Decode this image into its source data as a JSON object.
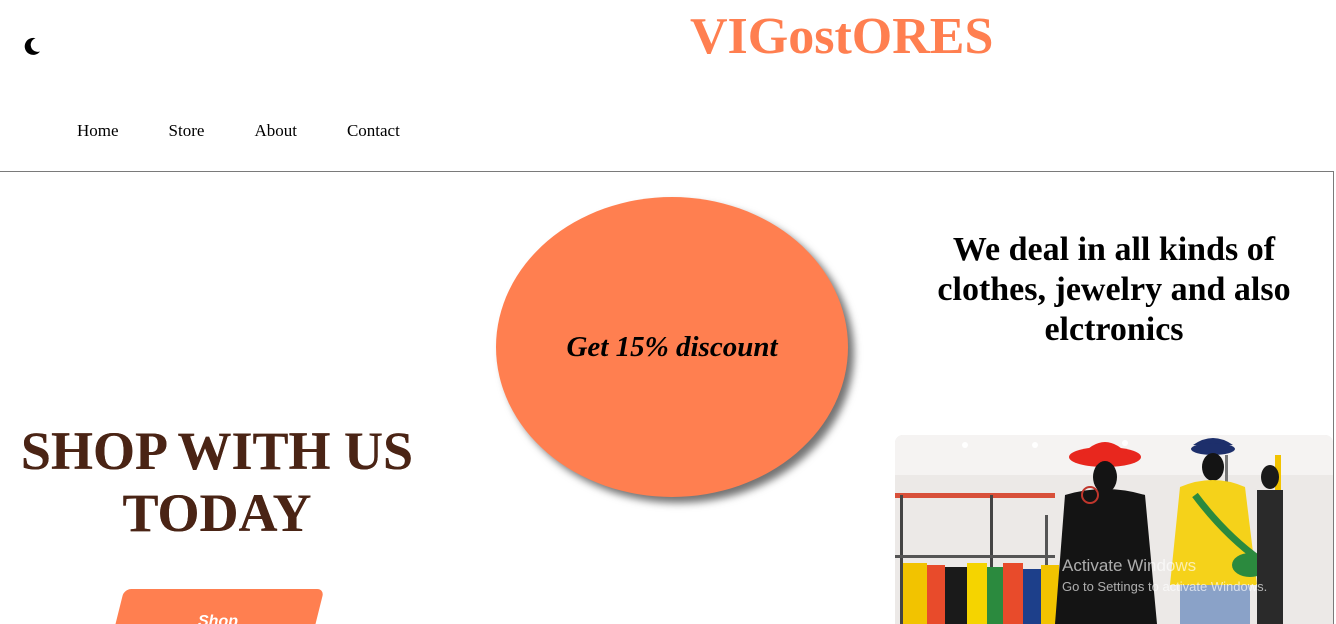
{
  "header": {
    "brand": "VIGostORES",
    "theme_toggle_icon": "moon-icon"
  },
  "nav": {
    "items": [
      {
        "label": "Home"
      },
      {
        "label": "Store"
      },
      {
        "label": "About"
      },
      {
        "label": "Contact"
      }
    ]
  },
  "hero": {
    "title_line1": "SHOP WITH US",
    "title_line2": "TODAY",
    "shop_button_label": "Shop"
  },
  "promo": {
    "discount_text": "Get 15% discount"
  },
  "tagline": {
    "text": "We deal in all kinds of clothes, jewelry and also elctronics"
  },
  "watermark": {
    "line1": "Activate Windows",
    "line2": "Go to Settings to activate Windows."
  },
  "colors": {
    "accent": "#ff7f50",
    "hero_text": "#4a2415"
  }
}
